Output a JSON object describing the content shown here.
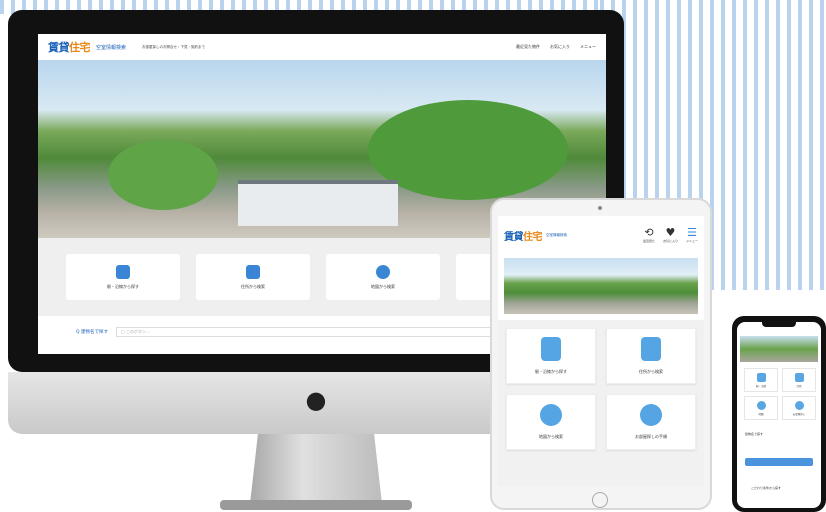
{
  "brand": {
    "logo_main": "賃貸",
    "logo_accent": "住宅",
    "logo_sub": "空室情報検索"
  },
  "desktop": {
    "tagline": "お部屋探しのお問合せ・下見・契約まで",
    "header_links": [
      "最近見た物件",
      "お気に入り",
      "メニュー"
    ],
    "cards": [
      "駅・沿線から探す",
      "住所から検索",
      "地図から検索"
    ],
    "search_label": "Q 建物名で探す",
    "search_placeholder": "□ このボタン…"
  },
  "tablet": {
    "header_icons": [
      {
        "glyph": "⟲",
        "label": "最近見た"
      },
      {
        "glyph": "♥",
        "label": "お気に入り"
      },
      {
        "glyph": "☰",
        "label": "メニュー"
      }
    ],
    "cards": [
      "駅・沿線から探す",
      "住所から検索",
      "地図から検索",
      "お部屋探しの手順"
    ]
  },
  "phone": {
    "cards": [
      "駅・沿線",
      "住所",
      "地図",
      "お部屋探し"
    ],
    "search_label": "建物名で探す",
    "bottom_text": "こだわり条件から探す"
  },
  "colors": {
    "brand_blue": "#1a62b8",
    "accent_orange": "#e8891a",
    "icon_blue": "#3a86d4"
  }
}
